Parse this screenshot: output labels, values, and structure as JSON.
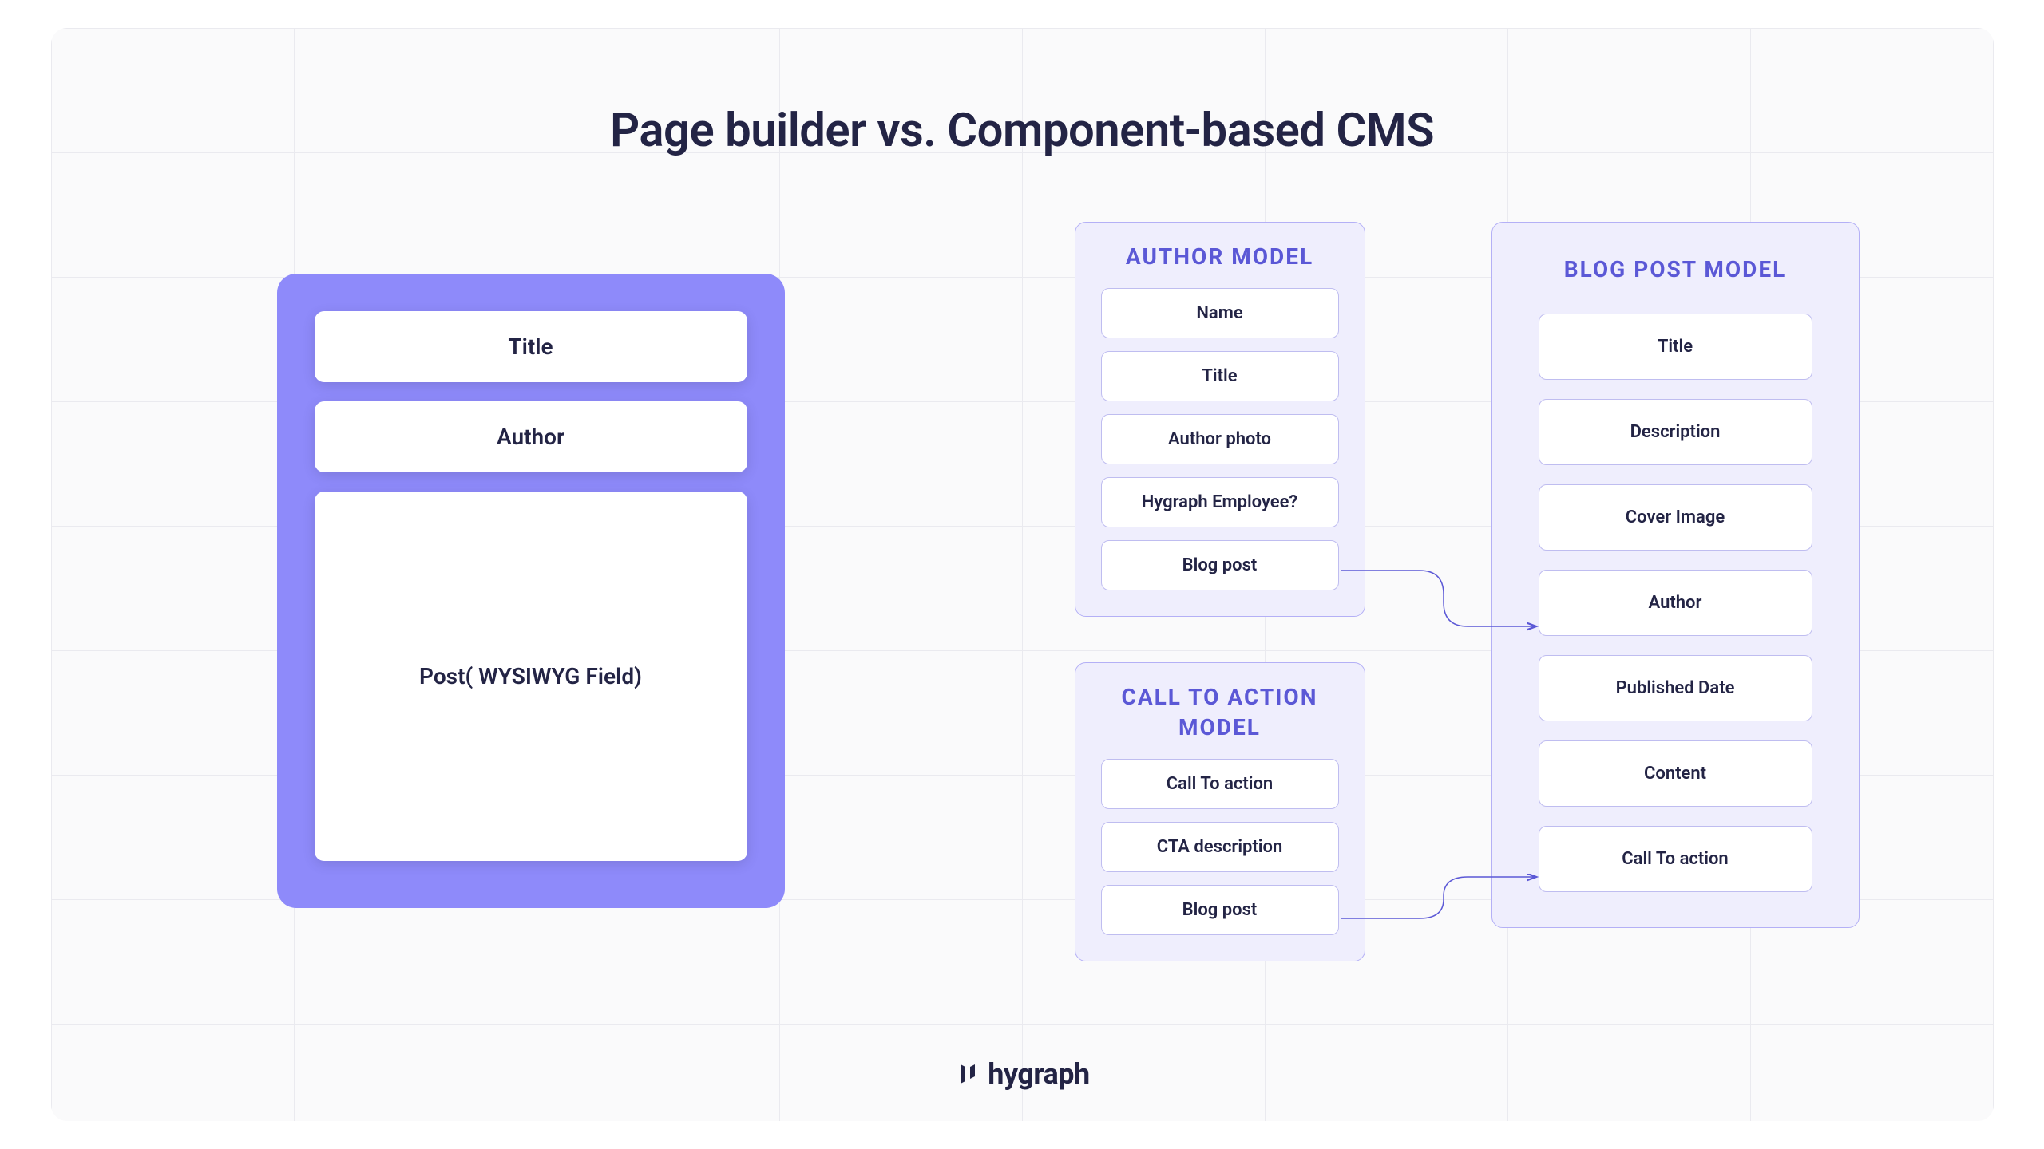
{
  "title": "Page builder vs. Component-based CMS",
  "brand": "hygraph",
  "page_builder": {
    "fields": {
      "title": "Title",
      "author": "Author",
      "post": "Post( WYSIWYG Field)"
    }
  },
  "author_model": {
    "title": "AUTHOR MODEL",
    "fields": {
      "name": "Name",
      "title": "Title",
      "photo": "Author photo",
      "employee": "Hygraph Employee?",
      "blog_post": "Blog post"
    }
  },
  "cta_model": {
    "title": "CALL TO ACTION MODEL",
    "fields": {
      "cta": "Call To action",
      "description": "CTA description",
      "blog_post": "Blog post"
    }
  },
  "blog_model": {
    "title": "BLOG POST MODEL",
    "fields": {
      "title": "Title",
      "description": "Description",
      "cover": "Cover Image",
      "author": "Author",
      "published": "Published Date",
      "content": "Content",
      "cta": "Call To action"
    }
  }
}
